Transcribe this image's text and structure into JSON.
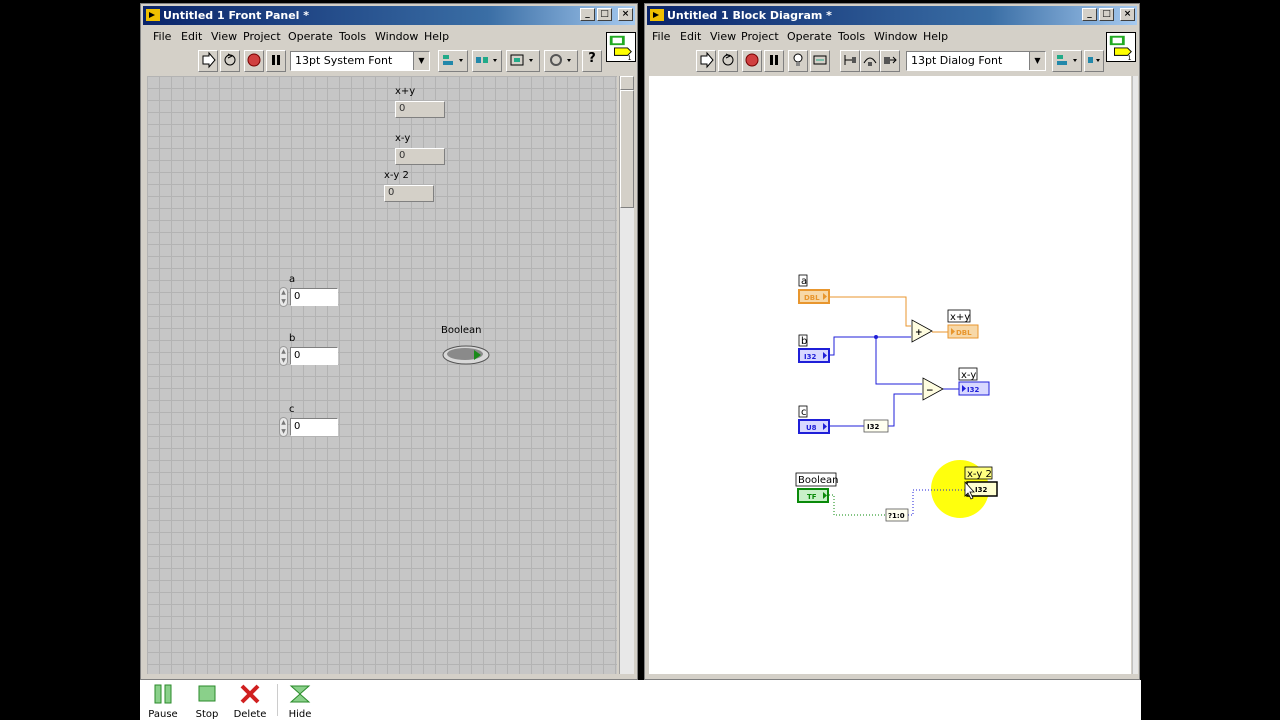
{
  "front_panel": {
    "title": "Untitled 1 Front Panel *",
    "menus": [
      "File",
      "Edit",
      "View",
      "Project",
      "Operate",
      "Tools",
      "Window",
      "Help"
    ],
    "font": "13pt System Font",
    "indicators": [
      {
        "label": "x+y",
        "value": "0"
      },
      {
        "label": "x-y",
        "value": "0"
      },
      {
        "label": "x-y 2",
        "value": "0"
      }
    ],
    "controls": [
      {
        "label": "a",
        "value": "0"
      },
      {
        "label": "b",
        "value": "0"
      },
      {
        "label": "c",
        "value": "0"
      }
    ],
    "boolean_label": "Boolean"
  },
  "block_diagram": {
    "title": "Untitled 1 Block Diagram *",
    "menus": [
      "File",
      "Edit",
      "View",
      "Project",
      "Operate",
      "Tools",
      "Window",
      "Help"
    ],
    "font": "13pt Dialog Font",
    "terminals": {
      "a": {
        "label": "a",
        "type": "DBL"
      },
      "b": {
        "label": "b",
        "type": "I32"
      },
      "c": {
        "label": "c",
        "type": "U8"
      },
      "xpy": {
        "label": "x+y",
        "type": "DBL"
      },
      "xmy": {
        "label": "x-y",
        "type": "I32"
      },
      "xmy2": {
        "label": "x-y 2",
        "type": "I32"
      },
      "bool": {
        "label": "Boolean",
        "type": "TF"
      }
    },
    "coercion": "I32",
    "bool_to_num": "?1:0",
    "add_symbol": "+",
    "sub_symbol": "−"
  },
  "colors": {
    "dbl": "#e8962e",
    "int": "#1f1fd8",
    "bool": "#0a8a0a",
    "highlight": "#ffff00"
  },
  "bottom_bar": {
    "pause": "Pause",
    "stop": "Stop",
    "delete": "Delete",
    "hide": "Hide"
  }
}
